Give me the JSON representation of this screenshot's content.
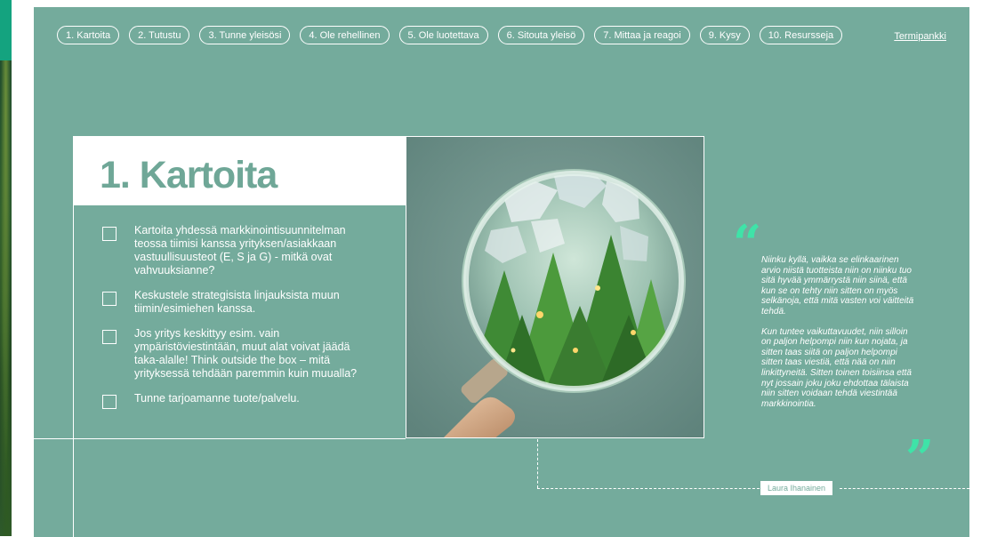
{
  "nav": {
    "items": [
      {
        "label": "1. Kartoita"
      },
      {
        "label": "2. Tutustu"
      },
      {
        "label": "3. Tunne yleisösi"
      },
      {
        "label": "4. Ole rehellinen"
      },
      {
        "label": "5. Ole luotettava"
      },
      {
        "label": "6. Sitouta yleisö"
      },
      {
        "label": "7. Mittaa ja reagoi"
      },
      {
        "label": "9. Kysy"
      },
      {
        "label": "10. Resursseja"
      }
    ],
    "term_link": "Termipankki"
  },
  "section": {
    "title": "1. Kartoita",
    "checklist": [
      {
        "text": "Kartoita yhdessä markkinointisuunnitelman teossa tiimisi kanssa yrityksen/asiakkaan vastuullisuusteot (E, S ja G) - mitkä ovat vahvuuksianne?"
      },
      {
        "text": "Keskustele strategisista linjauksista muun tiimin/esimiehen kanssa."
      },
      {
        "text": "Jos yritys keskittyy esim. vain ympäristöviestintään, muut alat voivat jäädä taka-alalle! Think outside the box – mitä yrityksessä tehdään paremmin kuin muualla?"
      },
      {
        "text": "Tunne tarjoamanne tuote/palvelu."
      }
    ]
  },
  "quote": {
    "open_mark": "“",
    "close_mark": "”",
    "paragraphs": [
      "Niinku kyllä, vaikka se elinkaarinen arvio niistä tuotteista niin on niinku tuo sitä hyvää ymmärrystä niin siinä, että kun se on tehty niin sitten on myös selkänoja, että mitä vasten voi väitteitä tehdä.",
      "Kun tuntee vaikuttavuudet, niin silloin on paljon helpompi niin kun nojata, ja sitten taas siitä on paljon helpompi sitten taas viestiä, että nää on niin linkittyneitä. Sitten toinen toisiinsa että nyt jossain joku joku ehdottaa tälaista niin sitten voidaan tehdä viestintää markkinointia."
    ],
    "author": "Laura Ihanainen"
  },
  "colors": {
    "background": "#74ab9c",
    "accent": "#3fe3a8",
    "title": "#6fa797"
  }
}
